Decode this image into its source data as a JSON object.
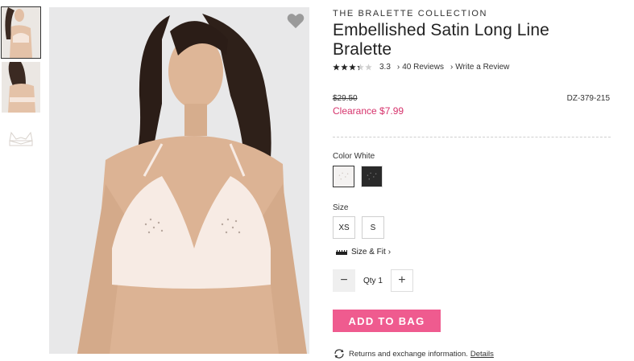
{
  "gallery": {
    "thumbnails": [
      {
        "icon": "model-front-thumbnail",
        "selected": true
      },
      {
        "icon": "model-back-thumbnail",
        "selected": false
      },
      {
        "icon": "product-flat-thumbnail",
        "selected": false
      }
    ],
    "favorite_icon": "heart-icon"
  },
  "product": {
    "collection": "THE BRALETTE COLLECTION",
    "title": "Embellished Satin Long Line Bralette",
    "rating": {
      "value": 3.3,
      "text": "3.3",
      "reviews_link": "40 Reviews",
      "write_review_link": "Write a Review"
    },
    "original_price": "$29.50",
    "clearance_price": "Clearance $7.99",
    "sku": "DZ-379-215"
  },
  "color": {
    "label": "Color White",
    "options": [
      {
        "name": "White",
        "hex": "#f4f2f1",
        "selected": true
      },
      {
        "name": "Black",
        "hex": "#2a2a2a",
        "selected": false
      }
    ]
  },
  "size": {
    "label": "Size",
    "options": [
      "XS",
      "S"
    ],
    "size_fit_link": "Size & Fit"
  },
  "quantity": {
    "label": "Qty 1",
    "minus": "−",
    "plus": "+"
  },
  "cart": {
    "add_label": "ADD TO BAG",
    "accent": "#ef5b8f"
  },
  "returns": {
    "text": "Returns and exchange information.",
    "details_link": "Details"
  },
  "colors": {
    "clearance": "#d6336c",
    "page_bg": "#ffffff"
  }
}
